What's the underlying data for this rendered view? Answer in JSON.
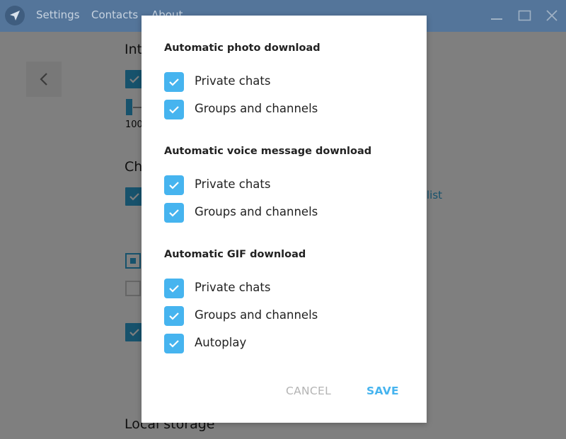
{
  "titlebar": {
    "menu": [
      "Settings",
      "Contacts",
      "About"
    ],
    "window_controls": [
      "minimize-icon",
      "maximize-icon",
      "close-icon"
    ]
  },
  "background": {
    "headings": [
      "Int",
      "Ch",
      "Local storage"
    ],
    "slider_value_text": "100",
    "link_text": "list"
  },
  "dialog": {
    "sections": [
      {
        "title": "Automatic photo download",
        "options": [
          {
            "label": "Private chats",
            "checked": true
          },
          {
            "label": "Groups and channels",
            "checked": true
          }
        ]
      },
      {
        "title": "Automatic voice message download",
        "options": [
          {
            "label": "Private chats",
            "checked": true
          },
          {
            "label": "Groups and channels",
            "checked": true
          }
        ]
      },
      {
        "title": "Automatic GIF download",
        "options": [
          {
            "label": "Private chats",
            "checked": true
          },
          {
            "label": "Groups and channels",
            "checked": true
          },
          {
            "label": "Autoplay",
            "checked": true
          }
        ]
      }
    ],
    "cancel_label": "CANCEL",
    "save_label": "SAVE"
  },
  "colors": {
    "titlebar": "#54759a",
    "accent": "#46b4ef",
    "cancel": "#b4b4b4"
  }
}
